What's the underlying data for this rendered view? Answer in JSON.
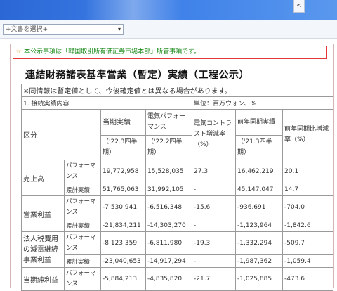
{
  "browser": {
    "scroll_label": "<"
  },
  "toolbar": {
    "doc_select_value": "+文書を選択+",
    "doc_select_arrow": "▾"
  },
  "notice": {
    "mark": "☞",
    "text": "本公示事項は「韓国取引所有価証券市場本部」所管事項です。"
  },
  "document": {
    "title": "連結財務諸表基準営業（暫定）実績（工程公示）",
    "note": "※同情報は暫定値として、今後確定値とは異なる場合があります。",
    "section": "1. 接続実績内容",
    "unit": "単位：百万ウォン、%"
  },
  "table": {
    "headers": {
      "category": "区分",
      "current": "当期実績",
      "current_period": "（'22.3四半期）",
      "prev_quarter": "電気パフォーマンス",
      "prev_quarter_period": "（'22.2四半期）",
      "qoq": "電気コントラスト増減率（%）",
      "prev_year": "前年同期実績",
      "prev_year_period": "（'21.3四半期）",
      "yoy": "前年同期比増減率（%）"
    },
    "rows": [
      {
        "category": "売上高",
        "lines": [
          {
            "label": "パフォーマンス",
            "current": "19,772,958",
            "prev_quarter": "15,528,035",
            "qoq": "27.3",
            "prev_year": "16,462,219",
            "yoy": "20.1"
          },
          {
            "label": "累計実績",
            "current": "51,765,063",
            "prev_quarter": "31,992,105",
            "qoq": "-",
            "prev_year": "45,147,047",
            "yoy": "14.7"
          }
        ]
      },
      {
        "category": "営業利益",
        "lines": [
          {
            "label": "パフォーマンス",
            "current": "-7,530,941",
            "prev_quarter": "-6,516,348",
            "qoq": "-15.6",
            "prev_year": "-936,691",
            "yoy": "-704.0"
          },
          {
            "label": "累計実績",
            "current": "-21,834,211",
            "prev_quarter": "-14,303,270",
            "qoq": "-",
            "prev_year": "-1,123,964",
            "yoy": "-1,842.6"
          }
        ]
      },
      {
        "category": "法人税費用の減電継続事業利益",
        "lines": [
          {
            "label": "パフォーマンス",
            "current": "-8,123,359",
            "prev_quarter": "-6,811,980",
            "qoq": "-19.3",
            "prev_year": "-1,332,294",
            "yoy": "-509.7"
          },
          {
            "label": "累計実績",
            "current": "-23,040,653",
            "prev_quarter": "-14,917,294",
            "qoq": "-",
            "prev_year": "-1,987,362",
            "yoy": "-1,059.4"
          }
        ]
      },
      {
        "category": "当期純利益",
        "lines": [
          {
            "label": "パフォーマンス",
            "current": "-5,884,213",
            "prev_quarter": "-4,835,820",
            "qoq": "-21.7",
            "prev_year": "-1,025,885",
            "yoy": "-473.6"
          }
        ]
      }
    ]
  }
}
